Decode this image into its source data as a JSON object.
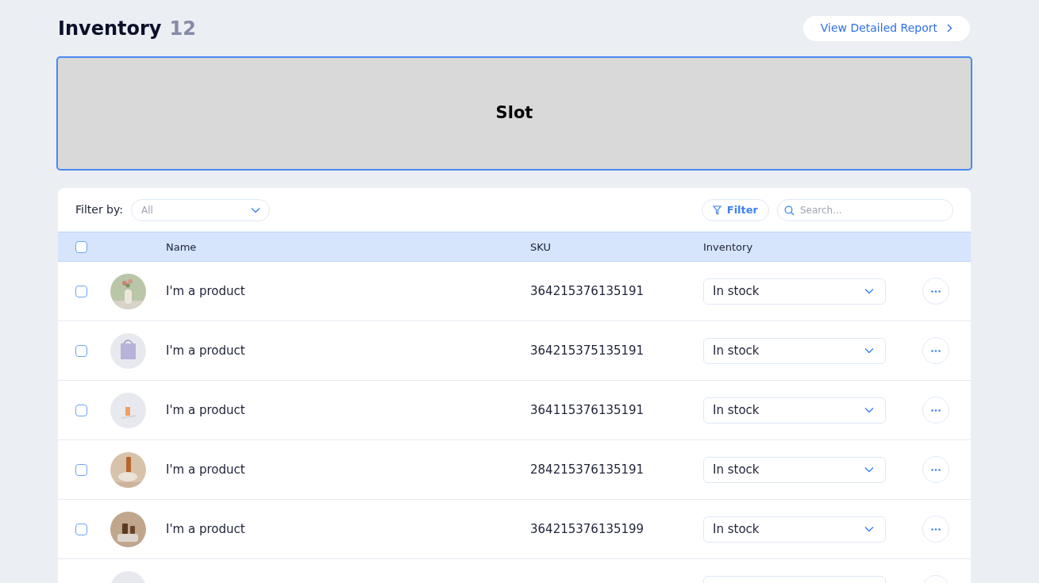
{
  "header": {
    "title": "Inventory",
    "count": "12",
    "report_button": "View Detailed Report"
  },
  "slot": {
    "label": "Slot"
  },
  "toolbar": {
    "filter_label": "Filter by:",
    "filter_value": "All",
    "filter_button": "Filter",
    "search": {
      "placeholder": "Search..."
    }
  },
  "table": {
    "select_all": {
      "checked": false
    },
    "columns": [
      "Name",
      "SKU",
      "Inventory"
    ],
    "rows": [
      {
        "kind": "product",
        "checked": false,
        "name": "I'm a product",
        "sku": "364215376135191",
        "inventory": "In stock"
      },
      {
        "kind": "product",
        "checked": false,
        "name": "I'm a product",
        "sku": "364215375135191",
        "inventory": "In stock"
      },
      {
        "kind": "product",
        "checked": false,
        "name": "I'm a product",
        "sku": "364115376135191",
        "inventory": "In stock"
      },
      {
        "kind": "product",
        "checked": false,
        "name": "I'm a product",
        "sku": "284215376135191",
        "inventory": "In stock"
      },
      {
        "kind": "product",
        "checked": false,
        "name": "I'm a product",
        "sku": "364215376135199",
        "inventory": "In stock"
      },
      {
        "kind": "cut"
      }
    ]
  }
}
